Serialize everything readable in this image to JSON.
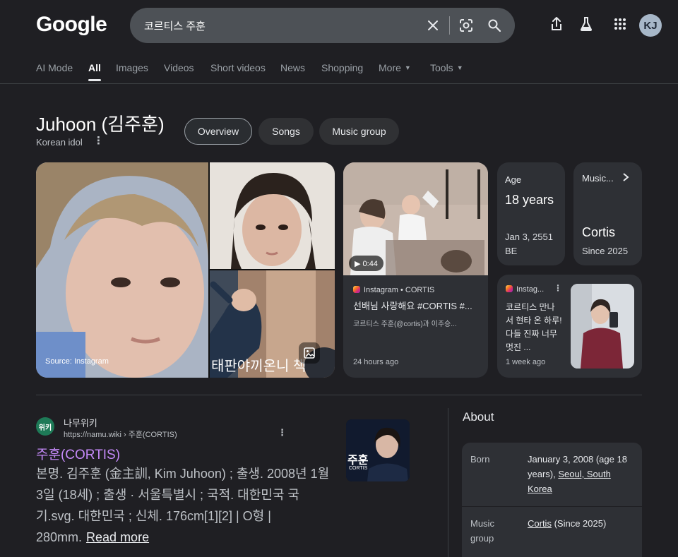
{
  "header": {
    "logo": "Google",
    "query": "코르티스 주훈",
    "avatar_initials": "KJ",
    "icons": [
      "close-icon",
      "lens-icon",
      "search-icon",
      "share-icon",
      "labs-icon",
      "apps-icon"
    ]
  },
  "tabs": [
    {
      "label": "AI Mode"
    },
    {
      "label": "All",
      "active": true
    },
    {
      "label": "Images"
    },
    {
      "label": "Videos"
    },
    {
      "label": "Short videos"
    },
    {
      "label": "News"
    },
    {
      "label": "Shopping"
    },
    {
      "label": "More",
      "caret": true
    },
    {
      "label": "Tools",
      "caret": true
    }
  ],
  "entity": {
    "title": "Juhoon (김주훈)",
    "subtitle": "Korean idol",
    "chips": [
      "Overview",
      "Songs",
      "Music group"
    ]
  },
  "images": {
    "source_caption": "Source: Instagram",
    "overlay_text": "태판야끼온니 책"
  },
  "video_card": {
    "duration": "▶ 0:44",
    "source": "Instagram • CORTIS",
    "title": "선배님 사랑해요 #CORTIS #...",
    "desc": "코르티스 주훈(@cortis)과 이주승...",
    "time": "24 hours ago"
  },
  "age_card": {
    "label": "Age",
    "value": "18 years",
    "detail": "Jan 3, 2551 BE"
  },
  "music_card": {
    "label": "Music...",
    "value": "Cortis",
    "detail": "Since 2025"
  },
  "ig_card": {
    "source": "Instag...",
    "text": "코르티스 만나 서 현타 온 하루! 다들 진짜 너무 멋진 ...",
    "time": "1 week ago"
  },
  "result": {
    "site_name": "나무위키",
    "site_url": "https://namu.wiki › 주훈(CORTIS)",
    "favicon_text": "위키",
    "title": "주훈(CORTIS)",
    "snippet": "본명. 김주훈 (金主訓, Kim Juhoon) ; 출생. 2008년 1월 3일 (18세) ; 출생 · 서울특별시 ; 국적. 대한민국 국기.svg. 대한민국 ; 신체. 176cm[1][2] | O형 | 280mm.",
    "read_more": "Read more",
    "thumb_text": "주훈",
    "thumb_sub": "CORTIS"
  },
  "about": {
    "heading": "About",
    "born_label": "Born",
    "born_value_a": "January 3, 2008 (age 18 years),",
    "born_value_link": "Seoul, South Korea",
    "music_label": "Music group",
    "music_link": "Cortis",
    "music_rest": "(Since 2025)"
  },
  "colors": {
    "background": "#1f1f23",
    "card": "#2e3035",
    "link_visited": "#c58af9",
    "search_box": "#4d5156"
  }
}
